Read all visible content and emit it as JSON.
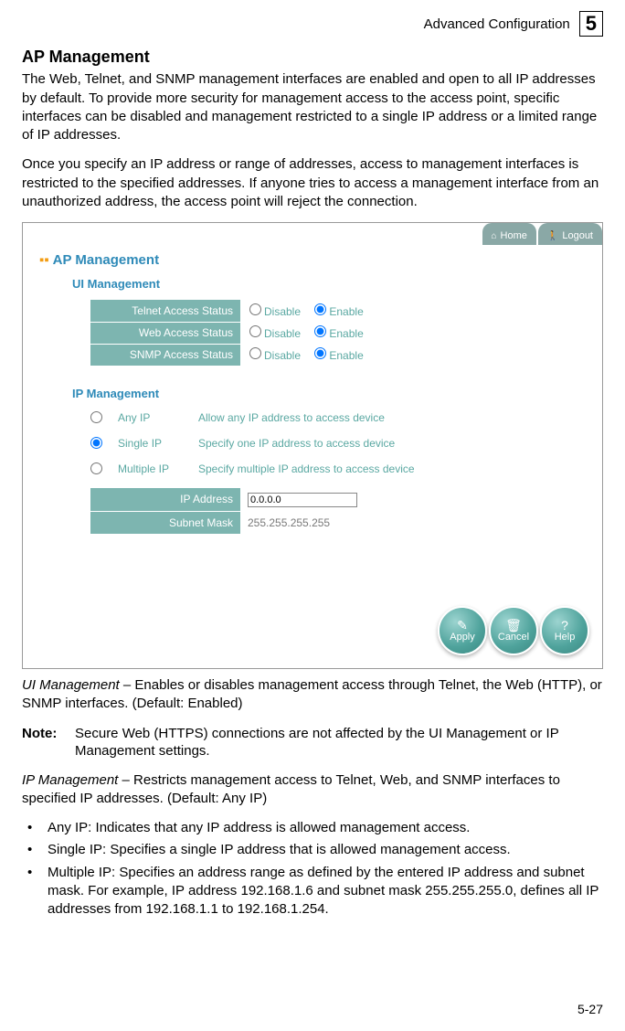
{
  "header": {
    "breadcrumb": "Advanced Configuration",
    "chapter": "5"
  },
  "section_title": "AP Management",
  "para1": "The Web, Telnet, and SNMP management interfaces are enabled and open to all IP addresses by default. To provide more security for management access to the access point, specific interfaces can be disabled and management restricted to a single IP address or a limited range of IP addresses.",
  "para2": "Once you specify an IP address or range of addresses, access to management interfaces is restricted to the specified addresses. If anyone tries to access a management interface from an unauthorized address, the access point will reject the connection.",
  "screenshot": {
    "topbar": {
      "home": "Home",
      "logout": "Logout"
    },
    "title": "AP Management",
    "ui_mgmt_title": "UI Management",
    "rows": {
      "telnet_label": "Telnet Access Status",
      "web_label": "Web Access Status",
      "snmp_label": "SNMP Access Status",
      "disable": "Disable",
      "enable": "Enable"
    },
    "ip_mgmt_title": "IP Management",
    "ip_opts": {
      "any": {
        "label": "Any IP",
        "desc": "Allow any IP address to access device"
      },
      "single": {
        "label": "Single IP",
        "desc": "Specify one IP address to access device"
      },
      "multiple": {
        "label": "Multiple IP",
        "desc": "Specify multiple IP address to access device"
      }
    },
    "ip_fields": {
      "ip_label": "IP Address",
      "ip_value": "0.0.0.0",
      "mask_label": "Subnet Mask",
      "mask_value": "255.255.255.255"
    },
    "buttons": {
      "apply": "Apply",
      "cancel": "Cancel",
      "help": "Help"
    }
  },
  "desc_ui_prefix": "UI Management",
  "desc_ui_rest": " – Enables or disables management access through Telnet, the Web (HTTP), or SNMP interfaces. (Default: Enabled)",
  "note_label": "Note:",
  "note_text": "Secure Web (HTTPS) connections are not affected by the UI Management or IP Management settings.",
  "desc_ip_prefix": "IP Management",
  "desc_ip_rest": " – Restricts management access to Telnet, Web, and SNMP interfaces to specified IP addresses. (Default: Any IP)",
  "bullets": {
    "b1": "Any IP: Indicates that any IP address is allowed management access.",
    "b2": "Single IP: Specifies a single IP address that is allowed management access.",
    "b3": "Multiple IP: Specifies an address range as defined by the entered IP address and subnet mask. For example, IP address 192.168.1.6 and subnet mask 255.255.255.0, defines all IP addresses from 192.168.1.1 to 192.168.1.254."
  },
  "page_num": "5-27"
}
